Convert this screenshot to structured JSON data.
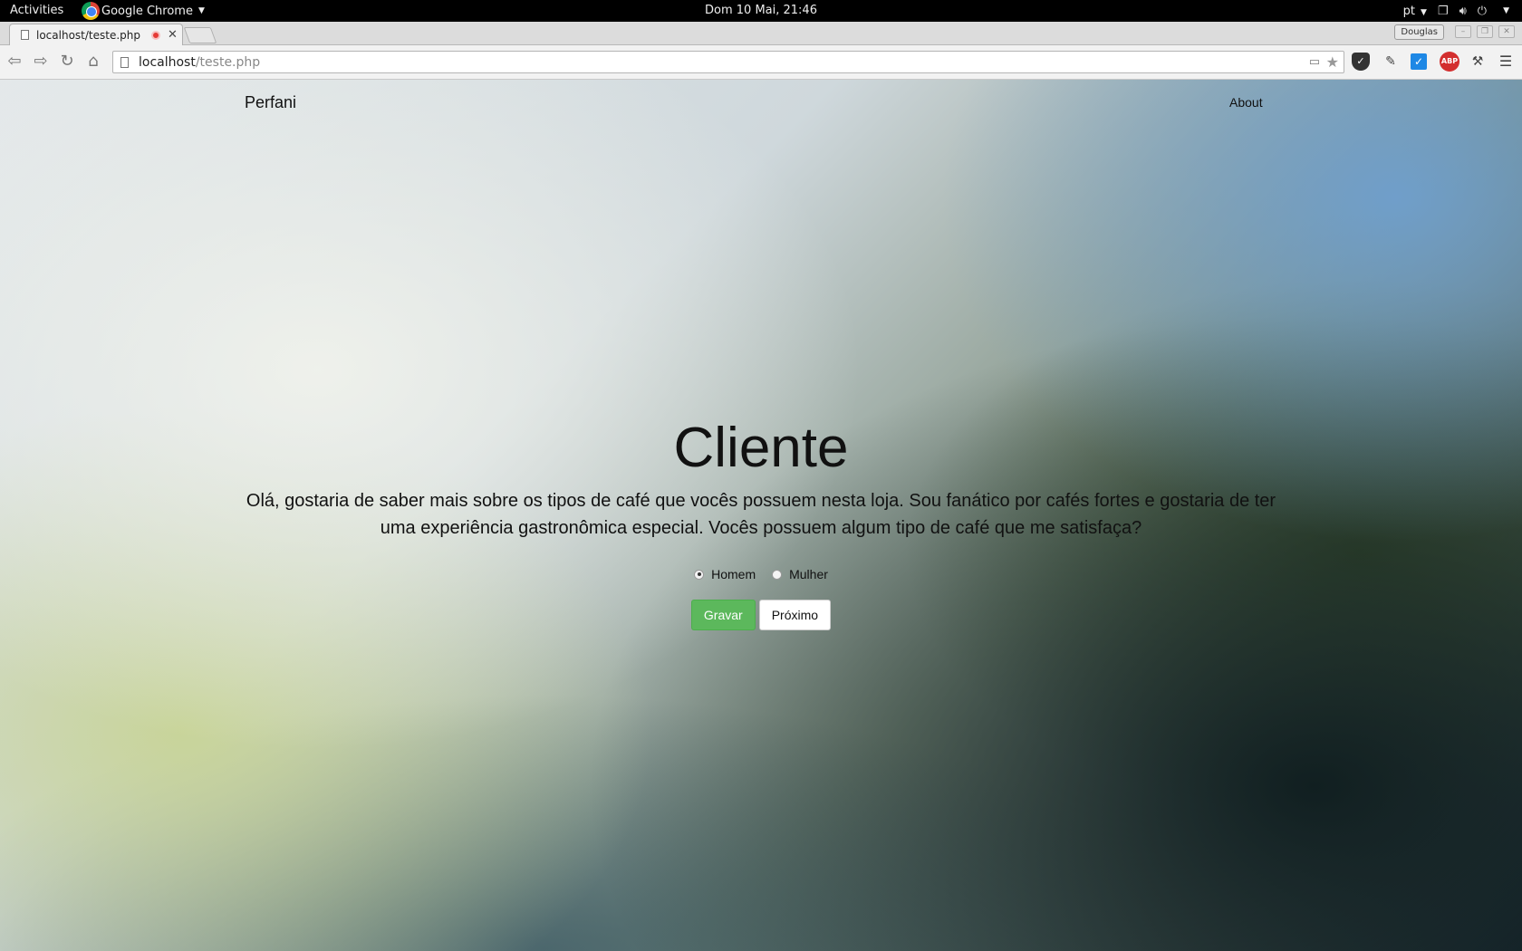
{
  "system_bar": {
    "activities": "Activities",
    "app_name": "Google Chrome",
    "clock": "Dom 10 Mai, 21:46",
    "language": "pt"
  },
  "browser": {
    "tab_title": "localhost/teste.php",
    "url_host": "localhost",
    "url_path": "/teste.php",
    "profile_name": "Douglas",
    "abp_label": "ABP"
  },
  "page": {
    "brand": "Perfani",
    "nav_about": "About",
    "heading": "Cliente",
    "message_line1": "Olá, gostaria de saber mais sobre os tipos de café que vocês possuem nesta loja. Sou fanático por cafés fortes e gostaria de ter",
    "message_line2": "uma experiência gastronômica especial. Vocês possuem algum tipo de café que me satisfaça?",
    "gender_options": [
      {
        "label": "Homem",
        "selected": true
      },
      {
        "label": "Mulher",
        "selected": false
      }
    ],
    "save_label": "Gravar",
    "next_label": "Próximo"
  },
  "colors": {
    "save_button": "#5cb85c",
    "abp_red": "#d32f2f",
    "check_blue": "#1e88e5"
  }
}
